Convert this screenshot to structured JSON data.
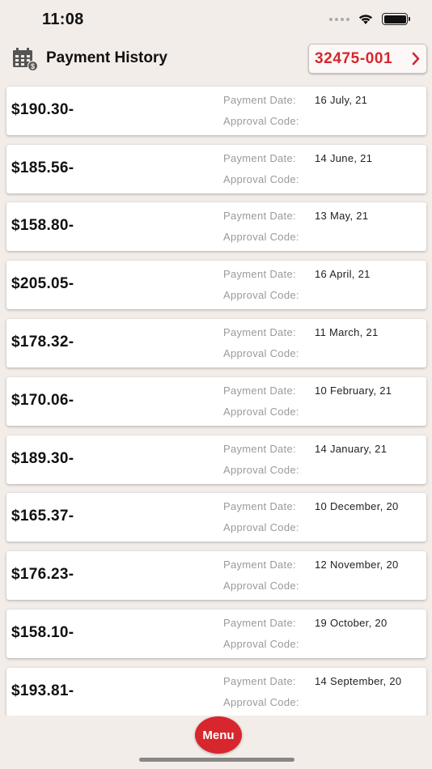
{
  "status_bar": {
    "time": "11:08"
  },
  "header": {
    "title": "Payment History",
    "account_number": "32475-001"
  },
  "labels": {
    "payment_date": "Payment Date:",
    "approval_code": "Approval Code:"
  },
  "payments": [
    {
      "amount": "$190.30-",
      "date": "16 July, 21",
      "approval_code": ""
    },
    {
      "amount": "$185.56-",
      "date": "14 June, 21",
      "approval_code": ""
    },
    {
      "amount": "$158.80-",
      "date": "13 May, 21",
      "approval_code": ""
    },
    {
      "amount": "$205.05-",
      "date": "16 April, 21",
      "approval_code": ""
    },
    {
      "amount": "$178.32-",
      "date": "11 March, 21",
      "approval_code": ""
    },
    {
      "amount": "$170.06-",
      "date": "10 February, 21",
      "approval_code": ""
    },
    {
      "amount": "$189.30-",
      "date": "14 January, 21",
      "approval_code": ""
    },
    {
      "amount": "$165.37-",
      "date": "10 December, 20",
      "approval_code": ""
    },
    {
      "amount": "$176.23-",
      "date": "12 November, 20",
      "approval_code": ""
    },
    {
      "amount": "$158.10-",
      "date": "19 October, 20",
      "approval_code": ""
    },
    {
      "amount": "$193.81-",
      "date": "14 September, 20",
      "approval_code": ""
    }
  ],
  "menu_button": {
    "label": "Menu"
  },
  "colors": {
    "accent": "#d7262d",
    "background": "#f3ede9"
  },
  "icons": [
    "calendar-dollar-icon",
    "chevron-right-icon",
    "wifi-icon",
    "battery-icon",
    "cellular-signal-icon"
  ]
}
